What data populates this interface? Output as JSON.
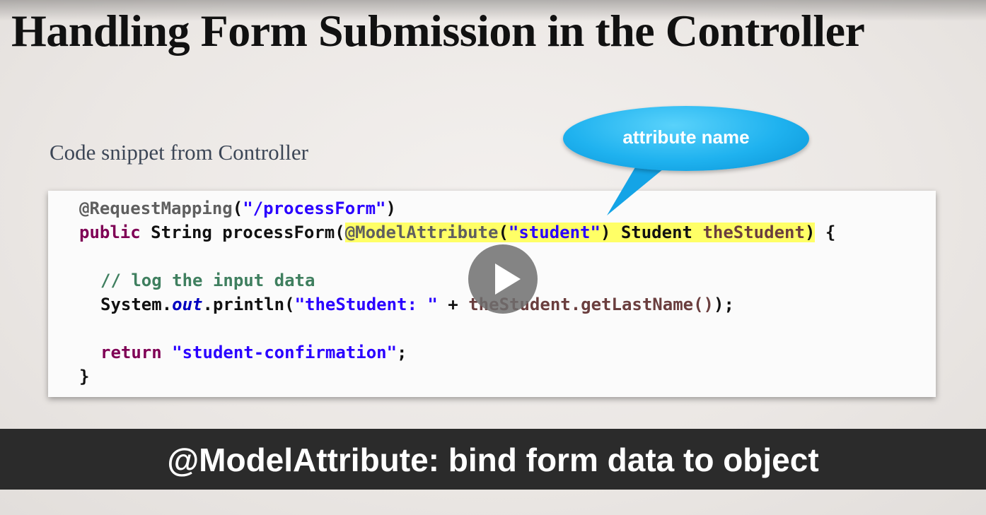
{
  "slide": {
    "title": "Handling Form Submission in the Controller",
    "subtitle": "Code snippet from Controller",
    "callout": {
      "text": "attribute name",
      "color": "#1fb2ef"
    }
  },
  "code": {
    "line1": {
      "annotation": "@RequestMapping",
      "open": "(",
      "string": "\"/processForm\"",
      "close": ")"
    },
    "line2": {
      "keyword": "public",
      "plain": " String processForm(",
      "annotation": "@ModelAttribute",
      "open": "(",
      "string": "\"student\"",
      "mid": ") Student ",
      "param": "theStudent",
      "close": ")",
      "brace": " {"
    },
    "line3": {
      "comment": "// log the input data"
    },
    "line4": {
      "object": "System.",
      "field": "out",
      "method": ".println(",
      "string": "\"theStudent: \"",
      "plus": " + ",
      "call": "theStudent.getLastName()",
      "end": ");"
    },
    "line5": {
      "keyword": "return",
      "space": " ",
      "string": "\"student-confirmation\"",
      "end": ";"
    },
    "line6": {
      "brace": "}"
    },
    "highlight_color": "#ffff66"
  },
  "player": {
    "play_icon": "play-icon"
  },
  "caption": {
    "text": "@ModelAttribute: bind form data to object"
  }
}
